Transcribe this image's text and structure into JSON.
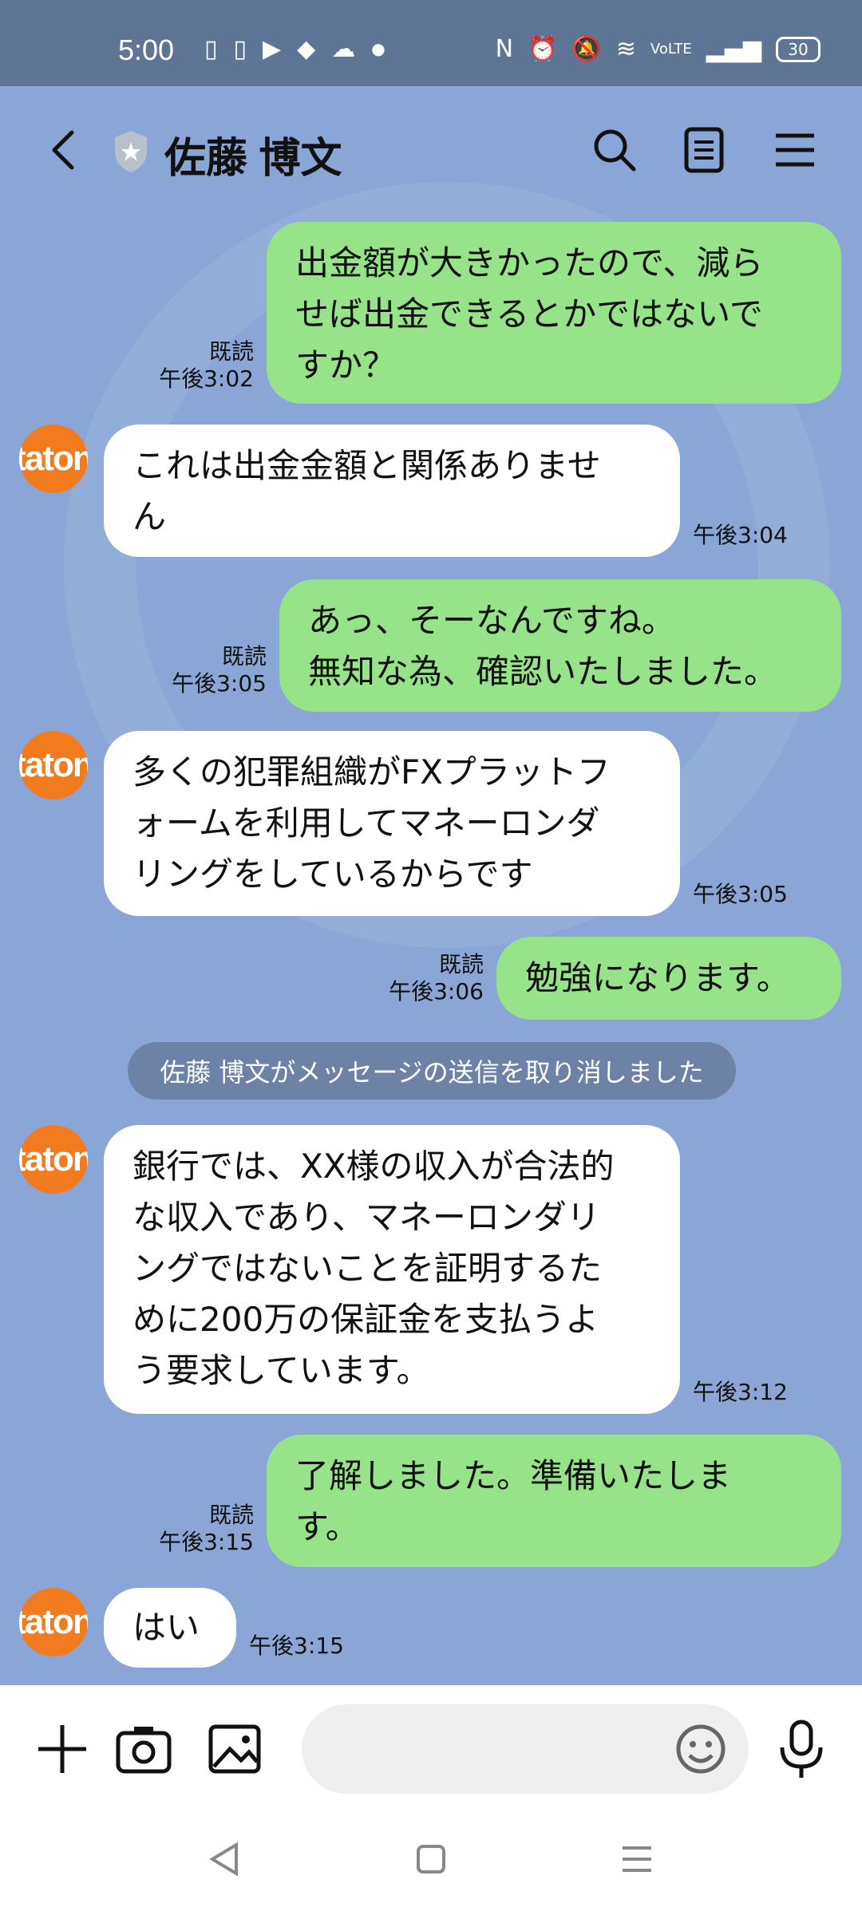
{
  "status_bar": {
    "time": "5:00",
    "battery": "30",
    "left_icons": [
      "sim-icon",
      "sim-icon",
      "youtube-icon",
      "cube-icon",
      "sheep-icon",
      "dot-icon"
    ],
    "right_icons": [
      "nfc-icon",
      "alarm-icon",
      "mute-icon",
      "wifi-icon",
      "volte-icon",
      "signal-icon"
    ]
  },
  "header": {
    "title": "佐藤 博文",
    "icons": [
      "back-icon",
      "shield-icon",
      "search-icon",
      "notes-icon",
      "menu-icon"
    ]
  },
  "messages": [
    {
      "side": "mine",
      "lines": [
        "出金額が大きかったので、減ら",
        "せば出金できるとかではないで",
        "すか？"
      ],
      "read": "既読",
      "time": "午後3:02"
    },
    {
      "side": "theirs",
      "avatar": "taton",
      "lines": [
        "これは出金金額と関係ありませ",
        "ん"
      ],
      "time": "午後3:04"
    },
    {
      "side": "mine",
      "lines": [
        "あっ、そーなんですね。",
        "無知な為、確認いたしました。"
      ],
      "read": "既読",
      "time": "午後3:05"
    },
    {
      "side": "theirs",
      "avatar": "taton",
      "lines": [
        "多くの犯罪組織がFXプラットフ",
        "ォームを利用してマネーロンダ",
        "リングをしているからです"
      ],
      "time": "午後3:05"
    },
    {
      "side": "mine",
      "lines": [
        "勉強になります。"
      ],
      "read": "既読",
      "time": "午後3:06"
    },
    {
      "side": "theirs",
      "avatar": "taton",
      "lines": [
        "銀行では、XX様の収入が合法的",
        "な収入であり、マネーロンダリ",
        "ングではないことを証明するた",
        "めに200万の保証金を支払うよ",
        "う要求しています。"
      ],
      "time": "午後3:12"
    },
    {
      "side": "mine",
      "lines": [
        "了解しました。準備いたしま",
        "す。"
      ],
      "read": "既読",
      "time": "午後3:15"
    },
    {
      "side": "theirs",
      "avatar": "taton",
      "lines": [
        "はい"
      ],
      "time": "午後3:15"
    }
  ],
  "system_message": "佐藤 博文がメッセージの送信を取り消しました",
  "input_bar": {
    "placeholder": "",
    "icons": [
      "plus-icon",
      "camera-icon",
      "image-icon",
      "emoji-icon",
      "mic-icon"
    ]
  },
  "nav_bar": {
    "icons": [
      "nav-back-icon",
      "nav-home-icon",
      "nav-recents-icon"
    ]
  },
  "colors": {
    "chat_bg": "#8aa6d6",
    "mine_bubble": "#97e38a",
    "theirs_bubble": "#ffffff",
    "avatar": "#f27b1f"
  }
}
